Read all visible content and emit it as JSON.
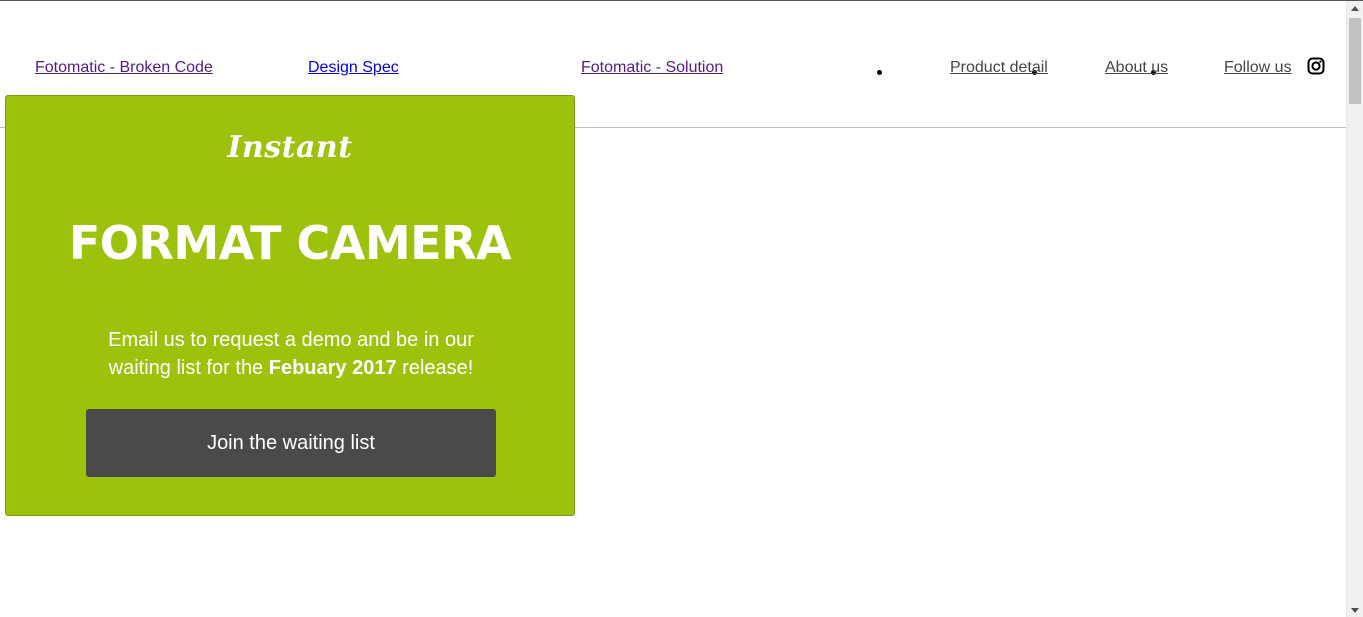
{
  "project_links": [
    {
      "label": "Fotomatic - Broken Code"
    },
    {
      "label": "Design Spec"
    },
    {
      "label": "Fotomatic - Solution"
    }
  ],
  "nav": {
    "items": [
      {
        "label": "Product detail"
      },
      {
        "label": "About us"
      },
      {
        "label": "Follow us "
      }
    ],
    "social_icon": "instagram-icon"
  },
  "hero": {
    "script_title": "Instant",
    "title": "FORMAT CAMERA",
    "text_before": "Email us to request a demo and be in our waiting list for the ",
    "text_bold": "Febuary 2017",
    "text_after": " release!",
    "button_label": "Join the waiting list",
    "background_color": "#9cc20c",
    "button_color": "#4a4a4a"
  },
  "colors": {
    "visited_link": "#551a8b",
    "link": "#0000ee",
    "nav_text": "#444444"
  }
}
